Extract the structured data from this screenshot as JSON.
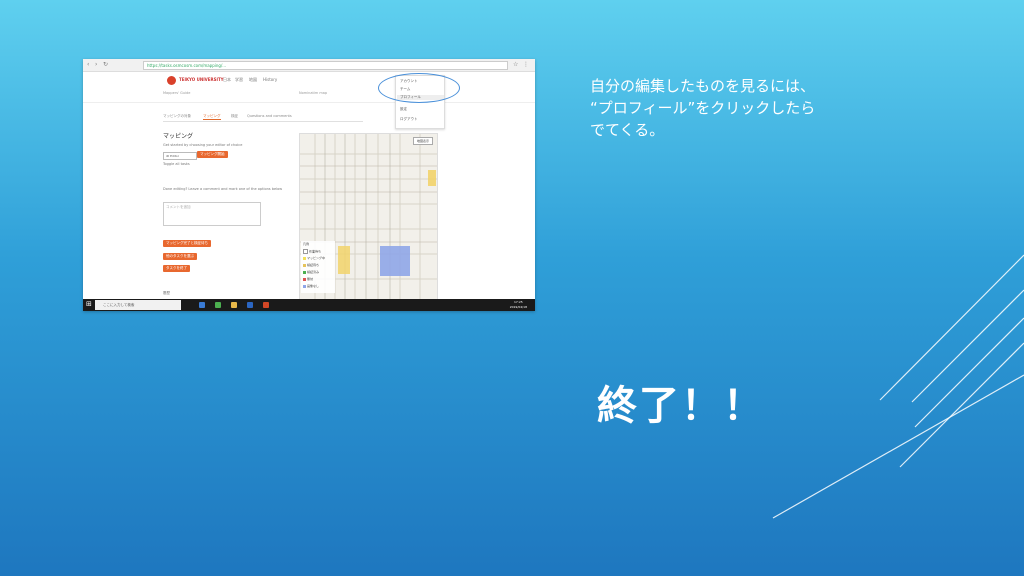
{
  "slide": {
    "caption": "自分の編集したものを見るには、\n“プロフィール”をクリックしたら\nでてくる。",
    "final_text": "終了！！"
  },
  "screenshot": {
    "url": "https://tasks.osmcosm.com/mapping/...",
    "site": {
      "name": "TEIKYO UNIVERSITY",
      "nav": [
        "日本",
        "学習",
        "地図",
        "History"
      ],
      "subtext_left": "Mappers' Guide",
      "subtext_right": "Nominatim map"
    },
    "user_menu": {
      "items": [
        "アカウント",
        "チーム",
        "プロフィール",
        "設定",
        "ログアウト"
      ]
    },
    "tabs": [
      "マッピングの対象",
      "マッピング",
      "検証",
      "Questions and comments"
    ],
    "panel": {
      "title": "マッピング",
      "intro": "Get started by choosing your editor of choice",
      "editor_select": "iD Editor",
      "start_button": "マッピング開始",
      "hint": "Toggle all tasks",
      "comment_label": "Done editing? Leave a comment and mark one of the options below",
      "comment_placeholder": "コメントを追加",
      "buttons": [
        "マッピング完了と検証待ち",
        "他のタスクを選ぶ",
        "タスクを終了"
      ],
      "footer_label": "履歴"
    },
    "map": {
      "button": "地図表示",
      "legend_title": "凡例",
      "legend": [
        {
          "label": "作業待ち",
          "color": "#ffffff"
        },
        {
          "label": "マッピング中",
          "color": "#f2e15a"
        },
        {
          "label": "検証待ち",
          "color": "#e6c45a"
        },
        {
          "label": "検証済み",
          "color": "#4caf50"
        },
        {
          "label": "無効",
          "color": "#e05252"
        },
        {
          "label": "画像なし",
          "color": "#8fa6e8"
        }
      ]
    },
    "taskbar": {
      "search_placeholder": "ここに入力して検索",
      "time": "17:25",
      "date": "2019/04/18"
    }
  }
}
